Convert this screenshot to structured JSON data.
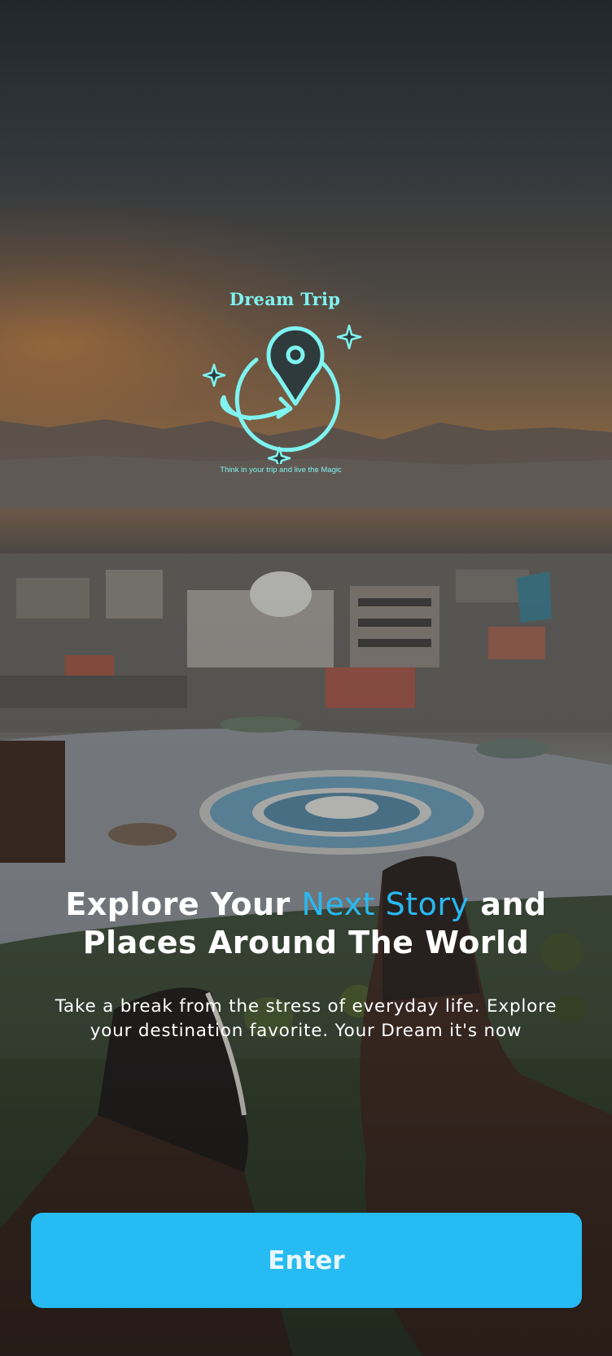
{
  "logo": {
    "title": "Dream Trip",
    "tagline": "Think in your trip and live the Magic",
    "icon": "globe-location-pin-icon",
    "color": "#7ff3f0"
  },
  "hero": {
    "headline_part1": "Explore Your ",
    "headline_accent": "Next Story",
    "headline_part2": " and Places Around The World",
    "accent_color": "#29b9f0",
    "subtitle": "Take a break from the stress of everyday life. Explore your destination favorite. Your Dream it's now"
  },
  "actions": {
    "enter_label": "Enter",
    "button_color": "#26bbf2"
  }
}
